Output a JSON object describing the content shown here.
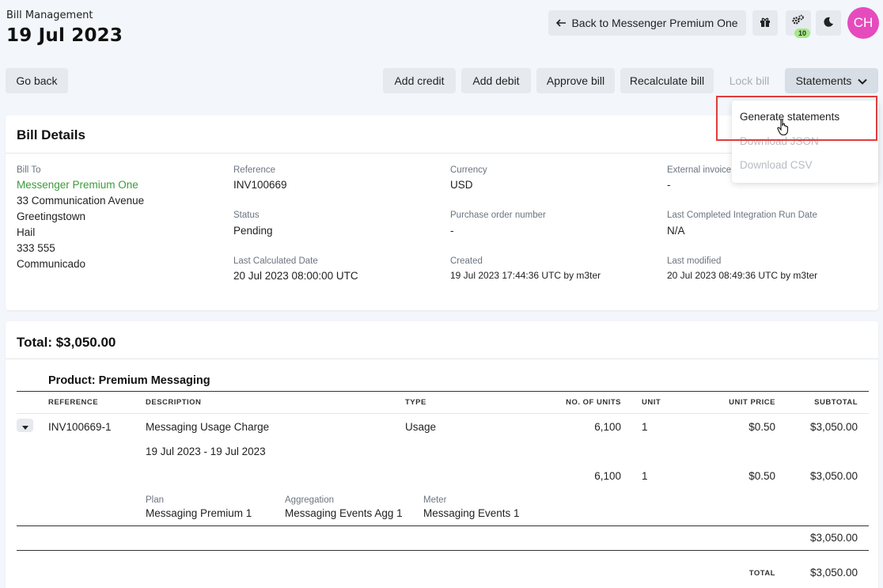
{
  "header": {
    "breadcrumb": "Bill Management",
    "title": "19 Jul 2023",
    "back_label": "Back to Messenger Premium One",
    "notification_count": "10",
    "avatar_initials": "CH"
  },
  "toolbar": {
    "go_back": "Go back",
    "add_credit": "Add credit",
    "add_debit": "Add debit",
    "approve_bill": "Approve bill",
    "recalculate_bill": "Recalculate bill",
    "lock_bill": "Lock bill",
    "statements": "Statements"
  },
  "statements_menu": {
    "items": [
      "Generate statements",
      "Download JSON",
      "Download CSV"
    ]
  },
  "bill_details": {
    "title": "Bill Details",
    "bill_to_label": "Bill To",
    "bill_to_name": "Messenger Premium One",
    "address": [
      "33 Communication Avenue",
      "Greetingstown",
      "Hail",
      "333 555",
      "Communicado"
    ],
    "reference_label": "Reference",
    "reference": "INV100669",
    "status_label": "Status",
    "status": "Pending",
    "last_calculated_label": "Last Calculated Date",
    "last_calculated": "20 Jul 2023 08:00:00 UTC",
    "currency_label": "Currency",
    "currency": "USD",
    "po_label": "Purchase order number",
    "po": "-",
    "created_label": "Created",
    "created": "19 Jul 2023 17:44:36 UTC by m3ter",
    "external_invoice_label": "External invoice",
    "external_invoice": "-",
    "last_integration_label": "Last Completed Integration Run Date",
    "last_integration": "N/A",
    "last_modified_label": "Last modified",
    "last_modified": "20 Jul 2023 08:49:36 UTC by m3ter"
  },
  "totals": {
    "title": "Total: $3,050.00",
    "product_title": "Product: Premium Messaging",
    "columns": [
      "REFERENCE",
      "DESCRIPTION",
      "TYPE",
      "NO. OF UNITS",
      "UNIT",
      "UNIT PRICE",
      "SUBTOTAL"
    ],
    "row": {
      "reference": "INV100669-1",
      "description": "Messaging Usage Charge",
      "type": "Usage",
      "units": "6,100",
      "unit": "1",
      "unit_price": "$0.50",
      "subtotal": "$3,050.00",
      "date_range": "19 Jul 2023 - 19 Jul 2023"
    },
    "subrow": {
      "units": "6,100",
      "unit": "1",
      "unit_price": "$0.50",
      "subtotal": "$3,050.00"
    },
    "plan_label": "Plan",
    "plan": "Messaging Premium 1",
    "aggregation_label": "Aggregation",
    "aggregation": "Messaging Events Agg 1",
    "meter_label": "Meter",
    "meter": "Messaging Events 1",
    "product_subtotal": "$3,050.00",
    "total_label": "TOTAL",
    "total": "$3,050.00"
  },
  "colors": {
    "link": "#3d9a3b",
    "avatar": "#e54bbd",
    "badge": "#a8e68b",
    "highlight": "#e23b3b"
  }
}
